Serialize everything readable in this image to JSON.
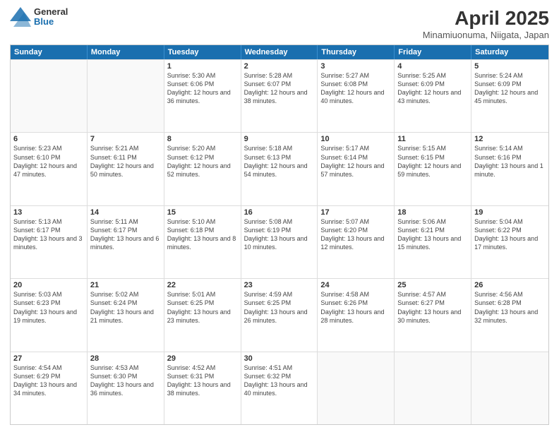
{
  "header": {
    "logo": {
      "general": "General",
      "blue": "Blue"
    },
    "title": "April 2025",
    "location": "Minamiuonuma, Niigata, Japan"
  },
  "calendar": {
    "days_of_week": [
      "Sunday",
      "Monday",
      "Tuesday",
      "Wednesday",
      "Thursday",
      "Friday",
      "Saturday"
    ],
    "weeks": [
      [
        {
          "day": "",
          "empty": true
        },
        {
          "day": "",
          "empty": true
        },
        {
          "day": "1",
          "sunrise": "Sunrise: 5:30 AM",
          "sunset": "Sunset: 6:06 PM",
          "daylight": "Daylight: 12 hours and 36 minutes."
        },
        {
          "day": "2",
          "sunrise": "Sunrise: 5:28 AM",
          "sunset": "Sunset: 6:07 PM",
          "daylight": "Daylight: 12 hours and 38 minutes."
        },
        {
          "day": "3",
          "sunrise": "Sunrise: 5:27 AM",
          "sunset": "Sunset: 6:08 PM",
          "daylight": "Daylight: 12 hours and 40 minutes."
        },
        {
          "day": "4",
          "sunrise": "Sunrise: 5:25 AM",
          "sunset": "Sunset: 6:09 PM",
          "daylight": "Daylight: 12 hours and 43 minutes."
        },
        {
          "day": "5",
          "sunrise": "Sunrise: 5:24 AM",
          "sunset": "Sunset: 6:09 PM",
          "daylight": "Daylight: 12 hours and 45 minutes."
        }
      ],
      [
        {
          "day": "6",
          "sunrise": "Sunrise: 5:23 AM",
          "sunset": "Sunset: 6:10 PM",
          "daylight": "Daylight: 12 hours and 47 minutes."
        },
        {
          "day": "7",
          "sunrise": "Sunrise: 5:21 AM",
          "sunset": "Sunset: 6:11 PM",
          "daylight": "Daylight: 12 hours and 50 minutes."
        },
        {
          "day": "8",
          "sunrise": "Sunrise: 5:20 AM",
          "sunset": "Sunset: 6:12 PM",
          "daylight": "Daylight: 12 hours and 52 minutes."
        },
        {
          "day": "9",
          "sunrise": "Sunrise: 5:18 AM",
          "sunset": "Sunset: 6:13 PM",
          "daylight": "Daylight: 12 hours and 54 minutes."
        },
        {
          "day": "10",
          "sunrise": "Sunrise: 5:17 AM",
          "sunset": "Sunset: 6:14 PM",
          "daylight": "Daylight: 12 hours and 57 minutes."
        },
        {
          "day": "11",
          "sunrise": "Sunrise: 5:15 AM",
          "sunset": "Sunset: 6:15 PM",
          "daylight": "Daylight: 12 hours and 59 minutes."
        },
        {
          "day": "12",
          "sunrise": "Sunrise: 5:14 AM",
          "sunset": "Sunset: 6:16 PM",
          "daylight": "Daylight: 13 hours and 1 minute."
        }
      ],
      [
        {
          "day": "13",
          "sunrise": "Sunrise: 5:13 AM",
          "sunset": "Sunset: 6:17 PM",
          "daylight": "Daylight: 13 hours and 3 minutes."
        },
        {
          "day": "14",
          "sunrise": "Sunrise: 5:11 AM",
          "sunset": "Sunset: 6:17 PM",
          "daylight": "Daylight: 13 hours and 6 minutes."
        },
        {
          "day": "15",
          "sunrise": "Sunrise: 5:10 AM",
          "sunset": "Sunset: 6:18 PM",
          "daylight": "Daylight: 13 hours and 8 minutes."
        },
        {
          "day": "16",
          "sunrise": "Sunrise: 5:08 AM",
          "sunset": "Sunset: 6:19 PM",
          "daylight": "Daylight: 13 hours and 10 minutes."
        },
        {
          "day": "17",
          "sunrise": "Sunrise: 5:07 AM",
          "sunset": "Sunset: 6:20 PM",
          "daylight": "Daylight: 13 hours and 12 minutes."
        },
        {
          "day": "18",
          "sunrise": "Sunrise: 5:06 AM",
          "sunset": "Sunset: 6:21 PM",
          "daylight": "Daylight: 13 hours and 15 minutes."
        },
        {
          "day": "19",
          "sunrise": "Sunrise: 5:04 AM",
          "sunset": "Sunset: 6:22 PM",
          "daylight": "Daylight: 13 hours and 17 minutes."
        }
      ],
      [
        {
          "day": "20",
          "sunrise": "Sunrise: 5:03 AM",
          "sunset": "Sunset: 6:23 PM",
          "daylight": "Daylight: 13 hours and 19 minutes."
        },
        {
          "day": "21",
          "sunrise": "Sunrise: 5:02 AM",
          "sunset": "Sunset: 6:24 PM",
          "daylight": "Daylight: 13 hours and 21 minutes."
        },
        {
          "day": "22",
          "sunrise": "Sunrise: 5:01 AM",
          "sunset": "Sunset: 6:25 PM",
          "daylight": "Daylight: 13 hours and 23 minutes."
        },
        {
          "day": "23",
          "sunrise": "Sunrise: 4:59 AM",
          "sunset": "Sunset: 6:25 PM",
          "daylight": "Daylight: 13 hours and 26 minutes."
        },
        {
          "day": "24",
          "sunrise": "Sunrise: 4:58 AM",
          "sunset": "Sunset: 6:26 PM",
          "daylight": "Daylight: 13 hours and 28 minutes."
        },
        {
          "day": "25",
          "sunrise": "Sunrise: 4:57 AM",
          "sunset": "Sunset: 6:27 PM",
          "daylight": "Daylight: 13 hours and 30 minutes."
        },
        {
          "day": "26",
          "sunrise": "Sunrise: 4:56 AM",
          "sunset": "Sunset: 6:28 PM",
          "daylight": "Daylight: 13 hours and 32 minutes."
        }
      ],
      [
        {
          "day": "27",
          "sunrise": "Sunrise: 4:54 AM",
          "sunset": "Sunset: 6:29 PM",
          "daylight": "Daylight: 13 hours and 34 minutes."
        },
        {
          "day": "28",
          "sunrise": "Sunrise: 4:53 AM",
          "sunset": "Sunset: 6:30 PM",
          "daylight": "Daylight: 13 hours and 36 minutes."
        },
        {
          "day": "29",
          "sunrise": "Sunrise: 4:52 AM",
          "sunset": "Sunset: 6:31 PM",
          "daylight": "Daylight: 13 hours and 38 minutes."
        },
        {
          "day": "30",
          "sunrise": "Sunrise: 4:51 AM",
          "sunset": "Sunset: 6:32 PM",
          "daylight": "Daylight: 13 hours and 40 minutes."
        },
        {
          "day": "",
          "empty": true
        },
        {
          "day": "",
          "empty": true
        },
        {
          "day": "",
          "empty": true
        }
      ]
    ]
  }
}
